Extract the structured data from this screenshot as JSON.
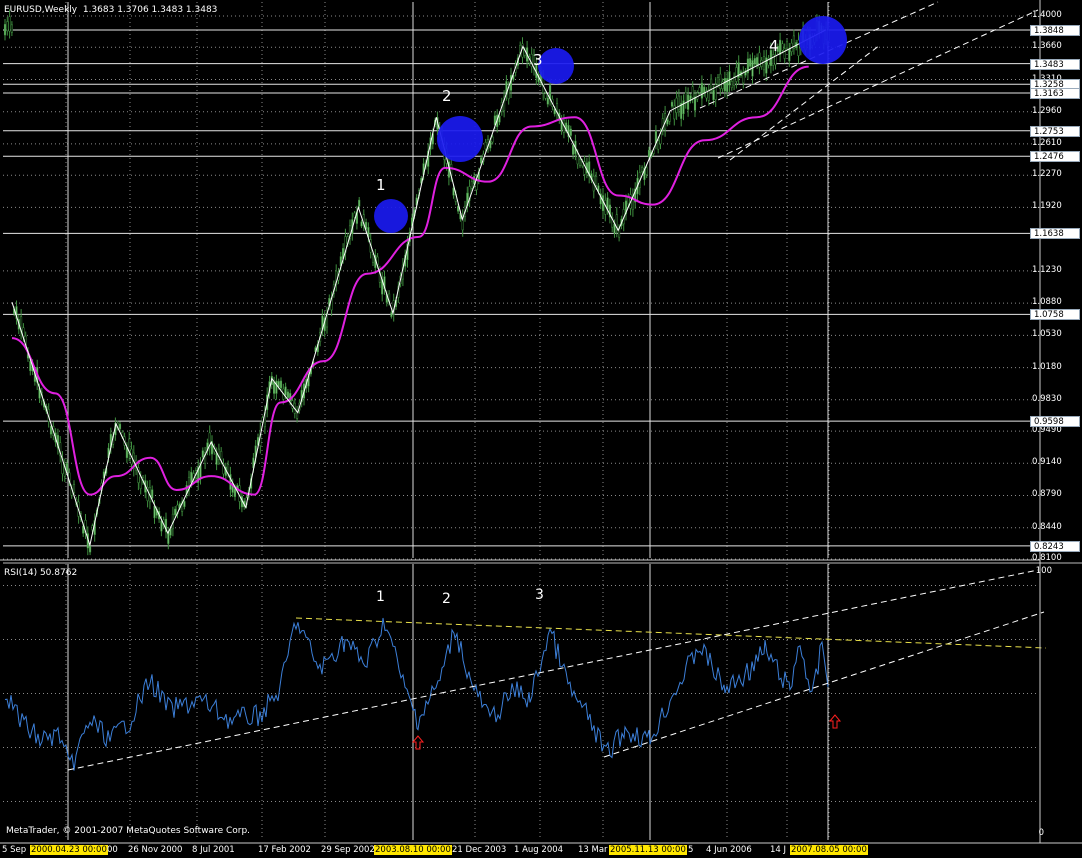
{
  "header": {
    "symbol": "EURUSD,Weekly",
    "ohlc": "1.3683 1.3706 1.3483 1.3483"
  },
  "rsi_header": "RSI(14) 50.8762",
  "copyright": "MetaTrader, © 2001-2007 MetaQuotes Software Corp.",
  "price_ticks": [
    "1.4000",
    "1.3660",
    "1.3310",
    "1.2960",
    "1.2610",
    "1.2270",
    "1.1920",
    "1.1230",
    "1.0880",
    "1.0530",
    "1.0180",
    "0.9830",
    "0.9490",
    "0.9140",
    "0.8790",
    "0.8440",
    "0.8100"
  ],
  "price_boxes": [
    "1.3848",
    "1.3483",
    "1.3258",
    "1.3163",
    "1.2753",
    "1.2476",
    "1.1638",
    "1.0758",
    "0.9598",
    "0.8243"
  ],
  "rsi_ticks": [
    "100",
    "0"
  ],
  "wave_labels": {
    "w1": "1",
    "w2": "2",
    "w3": "3",
    "w4": "4"
  },
  "rsi_wave_labels": {
    "r1": "1",
    "r2": "2",
    "r3": "3"
  },
  "time_labels": {
    "t1": "5 Sep",
    "t2": "2000.04.23 00:00",
    "t2b": "00",
    "t3": "26 Nov 2000",
    "t4": "8 Jul 2001",
    "t5": "17 Feb 2002",
    "t6": "29 Sep 2002",
    "t7": "2003.08.10 00:00",
    "t8": "21 Dec 2003",
    "t9": "1 Aug 2004",
    "t10": "13 Mar",
    "t11": "2005.11.13 00:00",
    "t11b": "5",
    "t12": "4 Jun 2006",
    "t13": "14 J",
    "t14": "2007.08.05 00:00"
  },
  "chart_data": {
    "type": "line",
    "title": "EURUSD,Weekly",
    "ylim": [
      0.81,
      1.4
    ],
    "grid": true,
    "background": "#000000",
    "colors": {
      "candles": "#3f9a3f",
      "moving_average": "#e020e0",
      "zigzag": "#ffffff",
      "rsi": "#3c7fd8",
      "rsi_trend_upper": "#e8e04a"
    },
    "series": [
      {
        "name": "zigzag",
        "points": [
          [
            "2000-01",
            1.089
          ],
          [
            "2000-10",
            0.825
          ],
          [
            "2001-01",
            0.957
          ],
          [
            "2001-07",
            0.838
          ],
          [
            "2001-12",
            0.937
          ],
          [
            "2002-04",
            0.866
          ],
          [
            "2002-07",
            1.006
          ],
          [
            "2002-10",
            0.969
          ],
          [
            "2003-05",
            1.192
          ],
          [
            "2003-09",
            1.077
          ],
          [
            "2004-02",
            1.29
          ],
          [
            "2004-05",
            1.179
          ],
          [
            "2004-12",
            1.367
          ],
          [
            "2005-11",
            1.167
          ],
          [
            "2006-05",
            1.297
          ],
          [
            "2007-11",
            1.385
          ]
        ]
      },
      {
        "name": "moving_average",
        "points": [
          [
            "2000-01",
            1.05
          ],
          [
            "2000-06",
            0.99
          ],
          [
            "2000-10",
            0.88
          ],
          [
            "2001-01",
            0.9
          ],
          [
            "2001-05",
            0.92
          ],
          [
            "2001-08",
            0.885
          ],
          [
            "2001-12",
            0.9
          ],
          [
            "2002-05",
            0.88
          ],
          [
            "2002-08",
            0.98
          ],
          [
            "2003-01",
            1.025
          ],
          [
            "2003-06",
            1.12
          ],
          [
            "2003-12",
            1.16
          ],
          [
            "2004-03",
            1.235
          ],
          [
            "2004-08",
            1.22
          ],
          [
            "2005-01",
            1.28
          ],
          [
            "2005-06",
            1.29
          ],
          [
            "2005-11",
            1.205
          ],
          [
            "2006-03",
            1.195
          ],
          [
            "2006-09",
            1.265
          ],
          [
            "2007-03",
            1.29
          ],
          [
            "2007-09",
            1.345
          ]
        ]
      }
    ],
    "rsi": {
      "period": 14,
      "last": 50.8762,
      "ylim": [
        0,
        100
      ]
    }
  }
}
